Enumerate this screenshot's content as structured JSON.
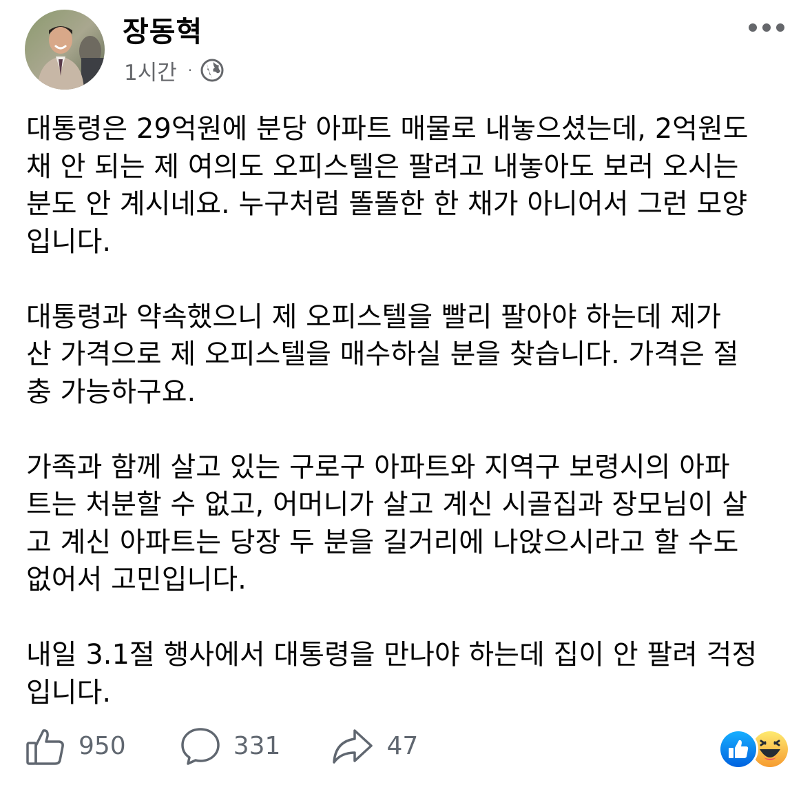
{
  "post": {
    "author": "장동혁",
    "time": "1시간",
    "separator": "·",
    "privacy_icon": "globe-icon",
    "more_icon": "more-horizontal-icon",
    "paragraphs": [
      "대통령은 29억원에 분당 아파트 매물로 내놓으셨는데, 2억원도\n채 안 되는 제 여의도 오피스텔은 팔려고 내놓아도 보러 오시는\n분도 안 계시네요. 누구처럼 똘똘한 한 채가 아니어서 그런 모양\n입니다.",
      "대통령과 약속했으니 제 오피스텔을 빨리 팔아야 하는데 제가\n산 가격으로 제 오피스텔을 매수하실 분을 찾습니다. 가격은 절\n충 가능하구요.",
      "가족과 함께 살고 있는 구로구 아파트와 지역구 보령시의 아파\n트는 처분할 수 없고, 어머니가 살고 계신 시골집과 장모님이 살\n고 계신 아파트는 당장 두 분을 길거리에 나앉으시라고 할 수도\n없어서 고민입니다.",
      "내일 3.1절 행사에서 대통령을 만나야 하는데 집이 안 팔려 걱정\n입니다."
    ]
  },
  "actions": {
    "like": {
      "icon": "thumbs-up-icon",
      "count": "950"
    },
    "comment": {
      "icon": "comment-bubble-icon",
      "count": "331"
    },
    "share": {
      "icon": "share-arrow-icon",
      "count": "47"
    }
  },
  "reactions": [
    "like-reaction-icon",
    "haha-reaction-icon"
  ],
  "colors": {
    "text_primary": "#050505",
    "text_secondary": "#65676b",
    "like_blue": "#1877f2",
    "haha_yellow": "#f7b125"
  }
}
